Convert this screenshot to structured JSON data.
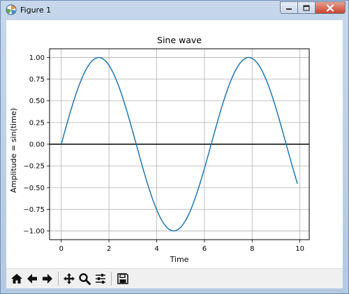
{
  "window": {
    "title": "Figure 1"
  },
  "toolbar": {
    "buttons": [
      {
        "icon": "home-icon"
      },
      {
        "icon": "back-arrow-icon"
      },
      {
        "icon": "forward-arrow-icon"
      },
      {
        "icon": "pan-icon"
      },
      {
        "icon": "zoom-icon"
      },
      {
        "icon": "subplots-config-icon"
      },
      {
        "icon": "save-icon"
      }
    ]
  },
  "colors": {
    "line": "#1f77b4",
    "axis_zero_line": "#000000",
    "grid": "#b0b0b0"
  },
  "chart_data": {
    "type": "line",
    "title": "Sine wave",
    "xlabel": "Time",
    "ylabel": "Amplitude = sin(time)",
    "xlim": [
      -0.49,
      10.39
    ],
    "ylim": [
      -1.1,
      1.1
    ],
    "xticks": [
      "0",
      "2",
      "4",
      "6",
      "8",
      "10"
    ],
    "yticks": [
      "1.00",
      "0.75",
      "0.50",
      "0.25",
      "0.00",
      "−0.25",
      "−0.50",
      "−0.75",
      "−1.00"
    ],
    "grid": true,
    "horizontal_line_y": 0,
    "series": [
      {
        "function": "sin(x)",
        "x_start": 0,
        "x_end": 9.9,
        "x_step": 0.1
      }
    ]
  }
}
